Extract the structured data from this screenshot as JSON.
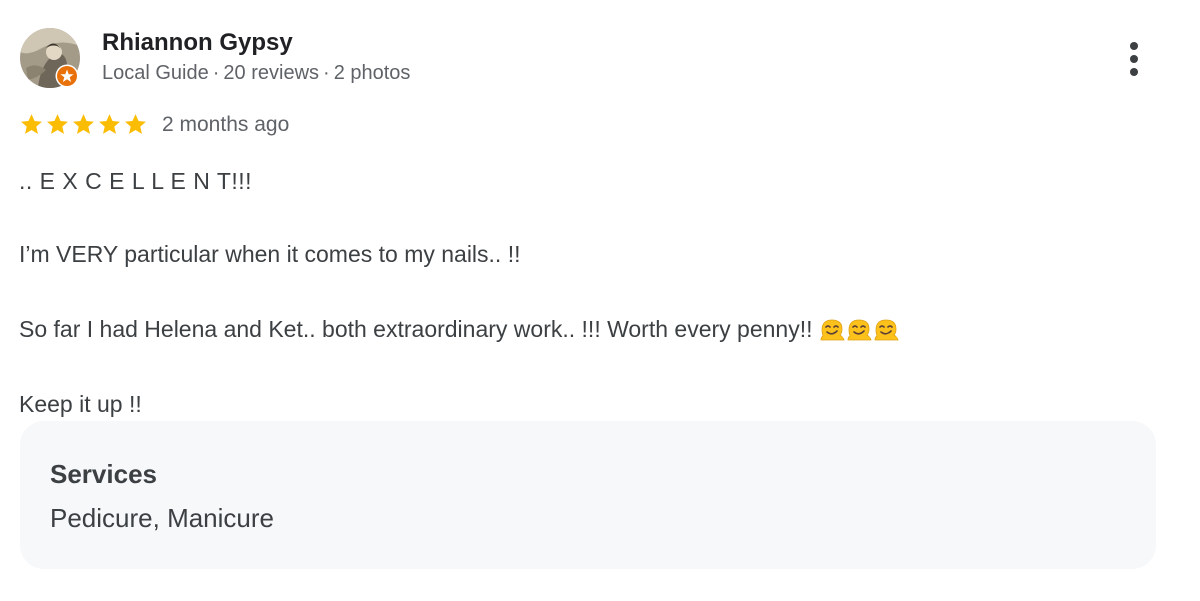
{
  "reviewer": {
    "name": "Rhiannon Gypsy",
    "badge": "Local Guide",
    "reviews": "20 reviews",
    "photos": "2 photos",
    "separator": "·",
    "avatar_icon": "profile-photo",
    "badge_icon": "local-guide-star-badge",
    "badge_color": "#e8710a"
  },
  "rating": {
    "stars": 5,
    "max_stars": 5,
    "star_color": "#fbbc04",
    "time": "2 months ago"
  },
  "review": {
    "lines": [
      ".. E X C E L L E N T!!!",
      "I’m VERY particular when it comes to my nails.. !!",
      "So far I had Helena and Ket.. both extraordinary work.. !!! Worth every penny!!",
      "Keep it up !!"
    ],
    "emoji_icon": "melting-face-emoji",
    "emoji_count": 3
  },
  "services": {
    "title": "Services",
    "value": "Pedicure, Manicure"
  },
  "menu": {
    "icon": "more-vertical-icon"
  }
}
